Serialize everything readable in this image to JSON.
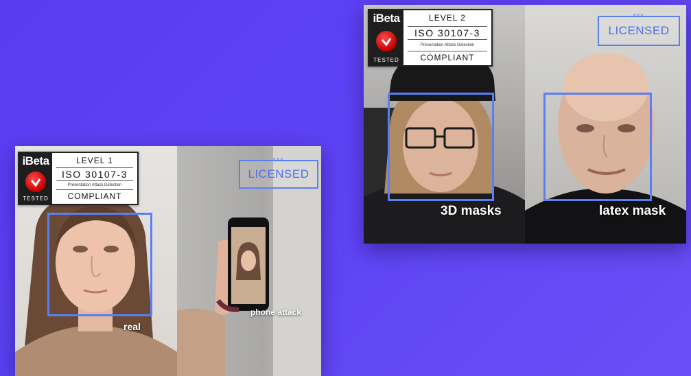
{
  "left_panel": {
    "badge": {
      "brand": "iBeta",
      "tested": "TESTED",
      "level": "LEVEL 1",
      "iso": "ISO 30107-3",
      "subtitle": "Presentation Attack Detection",
      "compliance": "COMPLIANT"
    },
    "licensed": {
      "dots": "•••",
      "label": "LICENSED"
    },
    "captions": {
      "real": "real",
      "phone_attack": "phone attack"
    }
  },
  "right_panel": {
    "badge": {
      "brand": "iBeta",
      "tested": "TESTED",
      "level": "LEVEL 2",
      "iso": "ISO 30107-3",
      "subtitle": "Presentation Attack Detection",
      "compliance": "COMPLIANT"
    },
    "licensed": {
      "dots": "•••",
      "label": "LICENSED"
    },
    "captions": {
      "masks_3d": "3D masks",
      "latex_mask": "latex mask"
    }
  },
  "colors": {
    "background": "#5d42f4",
    "frame_blue": "#5a7ff5",
    "badge_red": "#d40000"
  }
}
